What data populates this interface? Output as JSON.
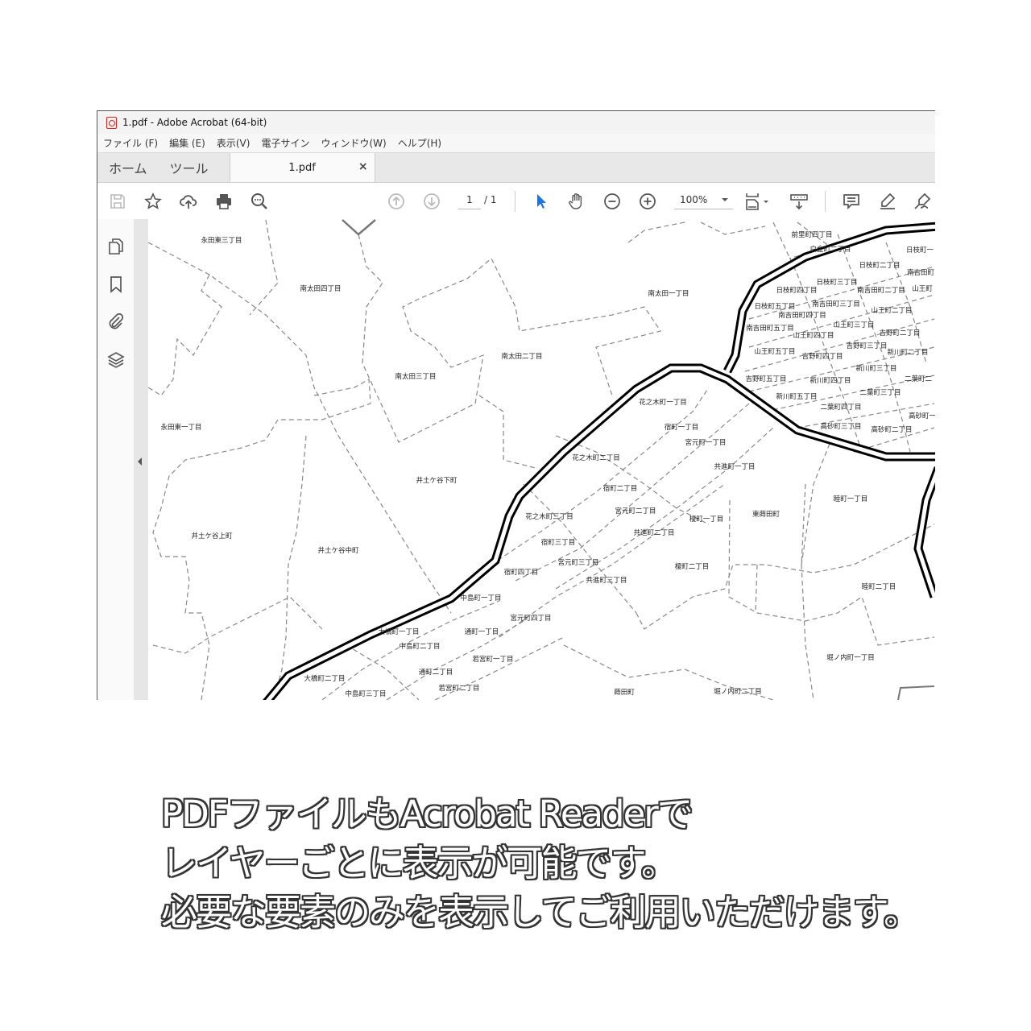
{
  "window": {
    "title": "1.pdf - Adobe Acrobat (64-bit)"
  },
  "menu": [
    "ファイル (F)",
    "編集 (E)",
    "表示(V)",
    "電子サイン",
    "ウィンドウ(W)",
    "ヘルプ(H)"
  ],
  "tabs": {
    "home": "ホーム",
    "tools": "ツール",
    "document": "1.pdf",
    "close": "×"
  },
  "toolbar": {
    "icons": [
      "save-icon",
      "bookmark-star-icon",
      "cloud-upload-icon",
      "print-icon",
      "search-zoom-icon",
      "page-up-icon",
      "page-down-icon",
      "select-cursor-icon",
      "hand-icon",
      "zoom-out-icon",
      "zoom-in-icon",
      "fit-page-icon",
      "scroll-mode-icon",
      "comment-icon",
      "highlight-icon",
      "sign-icon"
    ],
    "page_current": "1",
    "page_total": "/ 1",
    "zoom": "100%",
    "accent": "#1a73e8"
  },
  "leftpane": {
    "icons": [
      "pages-icon",
      "bookmark-icon",
      "attachment-icon",
      "layers-icon"
    ]
  },
  "map": {
    "labels": [
      "永田東三丁目",
      "南太田四丁目",
      "南太田一丁目",
      "南太田二丁目",
      "南太田三丁目",
      "永田東一丁目",
      "井土ケ谷下町",
      "井土ケ谷上町",
      "井土ケ谷中町",
      "花之木町一丁目",
      "宿町一丁目",
      "宮元町一丁目",
      "共進町一丁目",
      "花之木町二丁目",
      "宿町二丁目",
      "宮元町二丁目",
      "榎町一丁目",
      "共進町二丁目",
      "花之木町三丁目",
      "宿町三丁目",
      "宮元町三丁目",
      "宿町四丁目",
      "榎町二丁目",
      "共進町三丁目",
      "東蒔田町",
      "睦町一丁目",
      "睦町二丁目",
      "中島町一丁目",
      "宮元町四丁目",
      "大橋町一丁目",
      "通町一丁目",
      "中島町二丁目",
      "若宮町一丁目",
      "通町二丁目",
      "大橋町二丁目",
      "若宮町二丁目",
      "中島町三丁目",
      "蒔田町",
      "堀ノ内町二丁目",
      "堀ノ内町一丁目",
      "前里町四丁目",
      "白金町二丁目",
      "日枝町一",
      "日枝町二丁目",
      "南吉田町",
      "日枝町三丁目",
      "日枝町四丁目",
      "南吉田町二丁目",
      "山王町",
      "日枝町五丁目",
      "南吉田町三丁目",
      "山王町二丁目",
      "南吉田町四丁目",
      "南吉田町五丁目",
      "山王町三丁目",
      "山王町四丁目",
      "吉野町二丁目",
      "山王町五丁目",
      "吉野町三丁目",
      "吉野町四丁目",
      "新川町二丁目",
      "新川町三丁目",
      "吉野町五丁目",
      "新川町四丁目",
      "二葉町二",
      "二葉町三丁目",
      "新川町五丁目",
      "二葉町四丁目",
      "高砂町一",
      "高砂町三丁目",
      "高砂町二丁目"
    ]
  },
  "caption": {
    "line1": "PDFファイルもAcrobat Readerで",
    "line2": "レイヤーごとに表示が可能です。",
    "line3": "必要な要素のみを表示してご利用いただけます。"
  }
}
